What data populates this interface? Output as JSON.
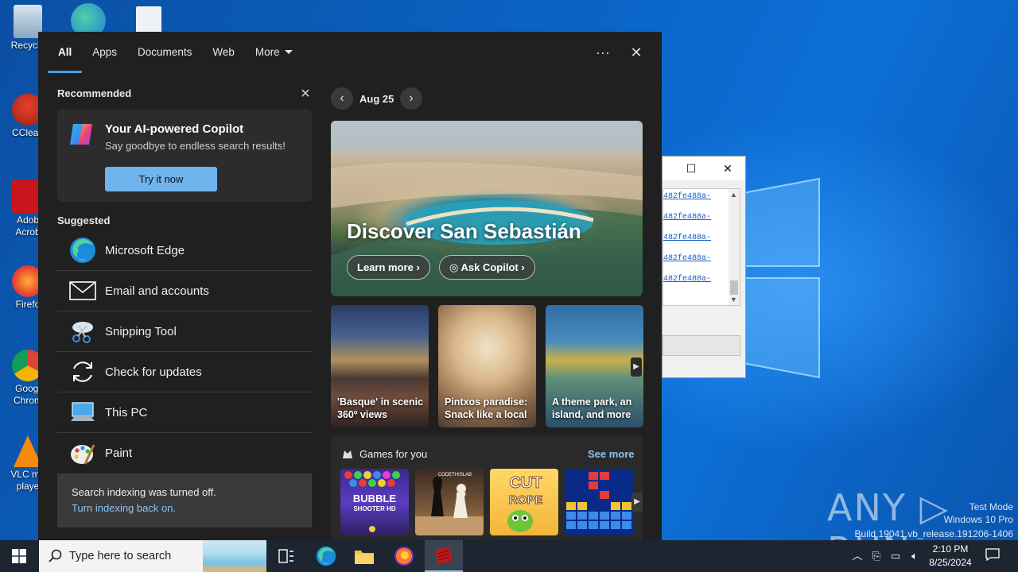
{
  "desktop": {
    "icons": [
      {
        "label": "Recycle",
        "name": "recycle-bin-icon"
      },
      {
        "label": "CClean",
        "name": "ccleaner-icon"
      },
      {
        "label": "Adob",
        "label2": "Acrob",
        "name": "adobe-acrobat-icon"
      },
      {
        "label": "Firefo",
        "name": "firefox-desktop-icon"
      },
      {
        "label": "Googl",
        "label2": "Chrom",
        "name": "chrome-desktop-icon"
      },
      {
        "label": "VLC me",
        "label2": "playe",
        "name": "vlc-desktop-icon"
      }
    ]
  },
  "bg_window": {
    "links": [
      "482fe488a-",
      "482fe488a-",
      "482fe488a-",
      "482fe488a-",
      "482fe488a-"
    ]
  },
  "search_panel": {
    "tabs": [
      {
        "label": "All",
        "active": true
      },
      {
        "label": "Apps"
      },
      {
        "label": "Documents"
      },
      {
        "label": "Web"
      },
      {
        "label": "More"
      }
    ],
    "recommended": {
      "heading": "Recommended",
      "card_title": "Your AI-powered Copilot",
      "card_sub": "Say goodbye to endless search results!",
      "button": "Try it now"
    },
    "suggested": {
      "heading": "Suggested",
      "items": [
        {
          "label": "Microsoft Edge",
          "icon": "edge-icon"
        },
        {
          "label": "Email and accounts",
          "icon": "mail-icon"
        },
        {
          "label": "Snipping Tool",
          "icon": "snipping-tool-icon"
        },
        {
          "label": "Check for updates",
          "icon": "refresh-icon"
        },
        {
          "label": "This PC",
          "icon": "this-pc-icon"
        },
        {
          "label": "Paint",
          "icon": "paint-icon"
        }
      ]
    },
    "indexing": {
      "message": "Search indexing was turned off.",
      "link": "Turn indexing back on."
    },
    "highlights": {
      "date": "Aug 25",
      "hero_title": "Discover San Sebastián",
      "learn_more": "Learn more",
      "ask_copilot": "Ask Copilot",
      "cards": [
        {
          "caption": "'Basque' in scenic 360º views"
        },
        {
          "caption": "Pintxos paradise: Snack like a local"
        },
        {
          "caption": "A theme park, an island, and more"
        }
      ],
      "games_heading": "Games for you",
      "see_more": "See more",
      "games": [
        {
          "title": "BUBBLE SHOOTER HD"
        },
        {
          "title": "CODETHISLAB"
        },
        {
          "title": "CUT the ROPE"
        },
        {
          "title": ""
        }
      ]
    }
  },
  "watermark": {
    "brand": "ANY RUN",
    "line1": "Test Mode",
    "line2": "Windows 10 Pro",
    "line3": "Build 19041.vb_release.191206-1406"
  },
  "taskbar": {
    "search_placeholder": "Type here to search",
    "time": "2:10 PM",
    "date": "8/25/2024"
  },
  "colors": {
    "accent": "#4aa0e6",
    "link": "#8cc4f2",
    "panel_bg": "#202020",
    "button": "#6fb4ec"
  }
}
